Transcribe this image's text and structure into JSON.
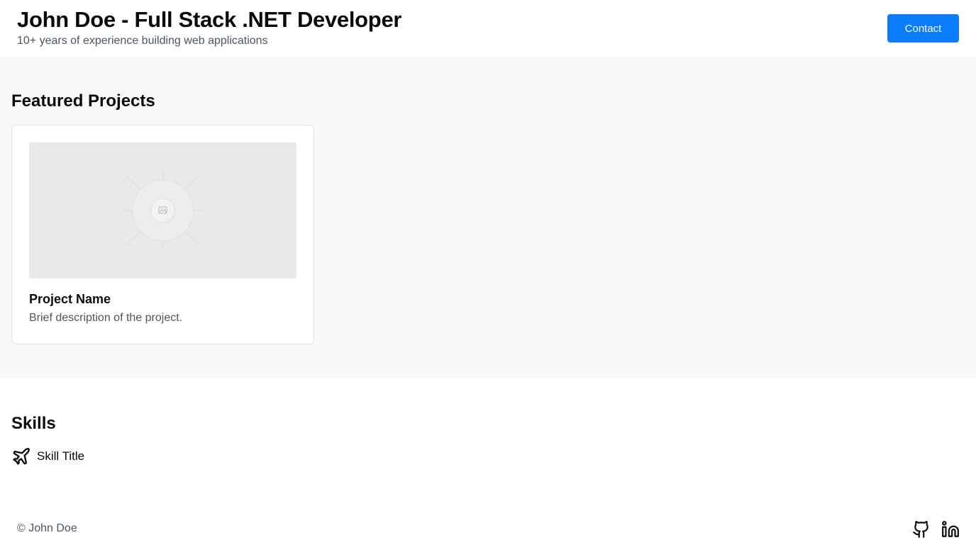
{
  "header": {
    "title": "John Doe - Full Stack .NET Developer",
    "subtitle": "10+ years of experience building web applications",
    "contact_label": "Contact"
  },
  "projects": {
    "heading": "Featured Projects",
    "items": [
      {
        "name": "Project Name",
        "description": "Brief description of the project.",
        "image_icon": "image-placeholder-icon"
      }
    ]
  },
  "skills": {
    "heading": "Skills",
    "items": [
      {
        "title": "Skill Title",
        "icon": "airplane-icon"
      }
    ]
  },
  "footer": {
    "copyright": "© John Doe",
    "social": [
      {
        "icon": "github-icon"
      },
      {
        "icon": "linkedin-icon"
      }
    ]
  },
  "colors": {
    "accent": "#0a7cff",
    "section_bg": "#f7f8fa",
    "muted_text": "#4b5563",
    "card_border": "#e3e5e8",
    "placeholder_bg": "#e9e9e9"
  }
}
